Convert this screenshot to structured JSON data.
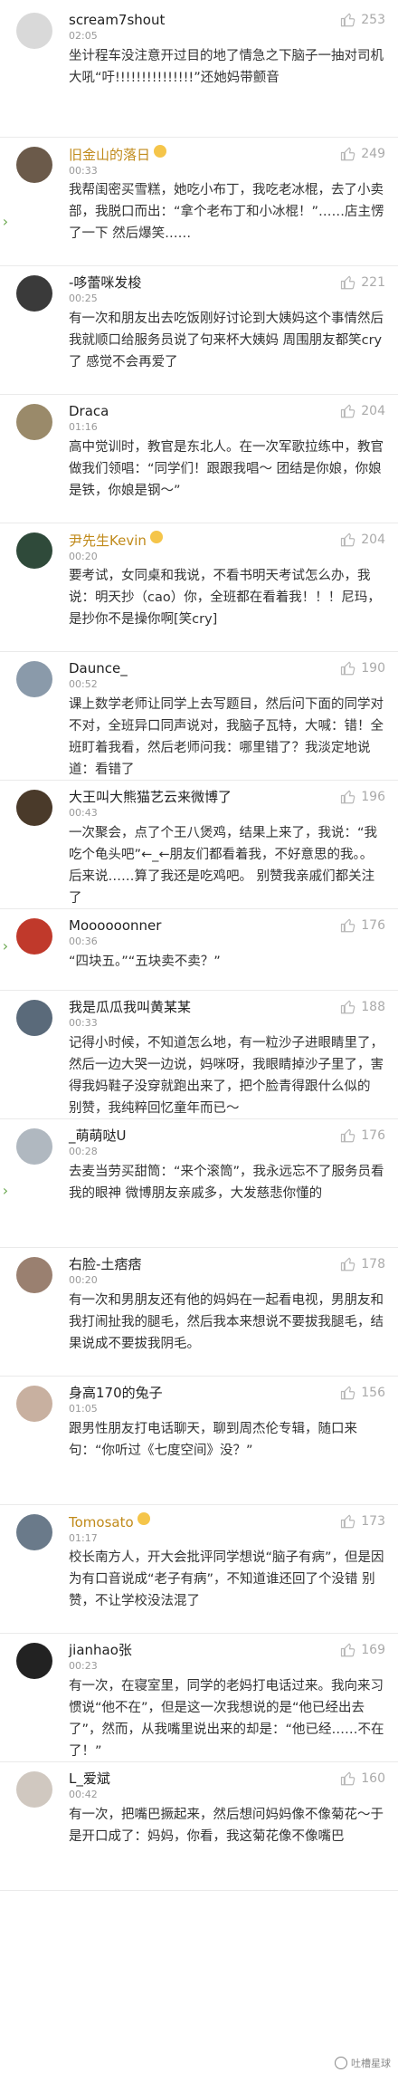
{
  "colors": {
    "like_icon": "#b7b7b7",
    "vip_name": "#c08a1a",
    "emoji": "#f7cc3a",
    "side_arrow": "#6aa84f"
  },
  "comments": [
    {
      "user": "scream7shout",
      "time": "02:05",
      "likes": "253",
      "vip": false,
      "text": "坐计程车没注意开过目的地了情急之下脑子一抽对司机大吼“吁!!!!!!!!!!!!!!!”还她妈带颤音",
      "avatar_color": "#d9d9d9"
    },
    {
      "user": "旧金山的落日",
      "time": "00:33",
      "likes": "249",
      "vip": true,
      "text": "我帮闺密买雪糕，她吃小布丁，我吃老冰棍，去了小卖部，我脱口而出：“拿个老布丁和小冰棍！”……店主愣了一下 然后爆笑……",
      "avatar_color": "#6b5a4a"
    },
    {
      "user": "-哆蕾咪发梭",
      "time": "00:25",
      "likes": "221",
      "vip": false,
      "text": "有一次和朋友出去吃饭刚好讨论到大姨妈这个事情然后我就顺口给服务员说了句来杯大姨妈 周围朋友都笑cry了 感觉不会再爱了",
      "avatar_color": "#3a3a3a"
    },
    {
      "user": "Draca",
      "time": "01:16",
      "likes": "204",
      "vip": false,
      "text": "高中觉训时，教官是东北人。在一次军歌拉练中，教官做我们领唱：“同学们！跟跟我唱～ 团结是你娘，你娘是铁，你娘是钢～”",
      "avatar_color": "#9a8a6a"
    },
    {
      "user": "尹先生Kevin",
      "time": "00:20",
      "likes": "204",
      "vip": true,
      "text": "要考试，女同桌和我说，不看书明天考试怎么办，我说：明天抄（cao）你，全班都在看着我！！！尼玛，是抄你不是操你啊[笑cry]",
      "avatar_color": "#2f4a3a"
    },
    {
      "user": "Daunce_",
      "time": "00:52",
      "likes": "190",
      "vip": false,
      "text": "课上数学老师让同学上去写题目，然后问下面的同学对不对，全班异口同声说对，我脑子瓦特，大喊：错！全班盯着我看，然后老师问我：哪里错了？我淡定地说道：看错了",
      "avatar_color": "#8a9aaa"
    },
    {
      "user": "大王叫大熊猫艺云来微博了",
      "time": "00:43",
      "likes": "196",
      "vip": false,
      "text": "一次聚会，点了个王八煲鸡，结果上来了，我说：“我吃个龟头吧”←_←朋友们都看着我，不好意思的我。。 后来说……算了我还是吃鸡吧。 别赞我亲戚们都关注了",
      "avatar_color": "#4a3a2a"
    },
    {
      "user": "Moooooonner",
      "time": "00:36",
      "likes": "176",
      "vip": false,
      "text": "“四块五。”“五块卖不卖？”",
      "avatar_color": "#c0392b"
    },
    {
      "user": "我是瓜瓜我叫黄某某",
      "time": "00:33",
      "likes": "188",
      "vip": false,
      "text": "记得小时候，不知道怎么地，有一粒沙子进眼睛里了，然后一边大哭一边说，妈咪呀，我眼睛掉沙子里了，害得我妈鞋子没穿就跑出来了，把个脸青得跟什么似的 别赞，我纯粹回忆童年而已～",
      "avatar_color": "#5a6a7a"
    },
    {
      "user": "_萌萌哒U",
      "time": "00:28",
      "likes": "176",
      "vip": false,
      "text": "去麦当劳买甜筒：“来个滚筒”，我永远忘不了服务员看我的眼神 微博朋友亲戚多，大发慈悲你懂的",
      "avatar_color": "#b0b8c0"
    },
    {
      "user": "右脸-土痞痞",
      "time": "00:20",
      "likes": "178",
      "vip": false,
      "text": "有一次和男朋友还有他的妈妈在一起看电视，男朋友和我打闹扯我的腿毛，然后我本来想说不要拔我腿毛，结果说成不要拔我阴毛。",
      "avatar_color": "#9a8070"
    },
    {
      "user": "身高170的兔子",
      "time": "01:05",
      "likes": "156",
      "vip": false,
      "text": "跟男性朋友打电话聊天，聊到周杰伦专辑，随口来句：“你听过《七度空间》没？”",
      "avatar_color": "#c8b0a0"
    },
    {
      "user": "Tomosato",
      "time": "01:17",
      "likes": "173",
      "vip": true,
      "text": "校长南方人，开大会批评同学想说“脑子有病”，但是因为有口音说成“老子有病”，不知道谁还回了个没错 别赞，不让学校没法混了",
      "avatar_color": "#6a7a8a"
    },
    {
      "user": "jianhao张",
      "time": "00:23",
      "likes": "169",
      "vip": false,
      "text": "有一次，在寝室里，同学的老妈打电话过来。我向来习惯说“他不在”，但是这一次我想说的是“他已经出去了”，然而，从我嘴里说出来的却是：“他已经……不在了！”",
      "avatar_color": "#222222"
    },
    {
      "user": "L_爱斌",
      "time": "00:42",
      "likes": "160",
      "vip": false,
      "text": "有一次，把嘴巴撅起来，然后想问妈妈像不像菊花～于是开口成了：妈妈，你看，我这菊花像不像嘴巴",
      "avatar_color": "#d0c8c0"
    }
  ],
  "watermark": "吐槽星球"
}
